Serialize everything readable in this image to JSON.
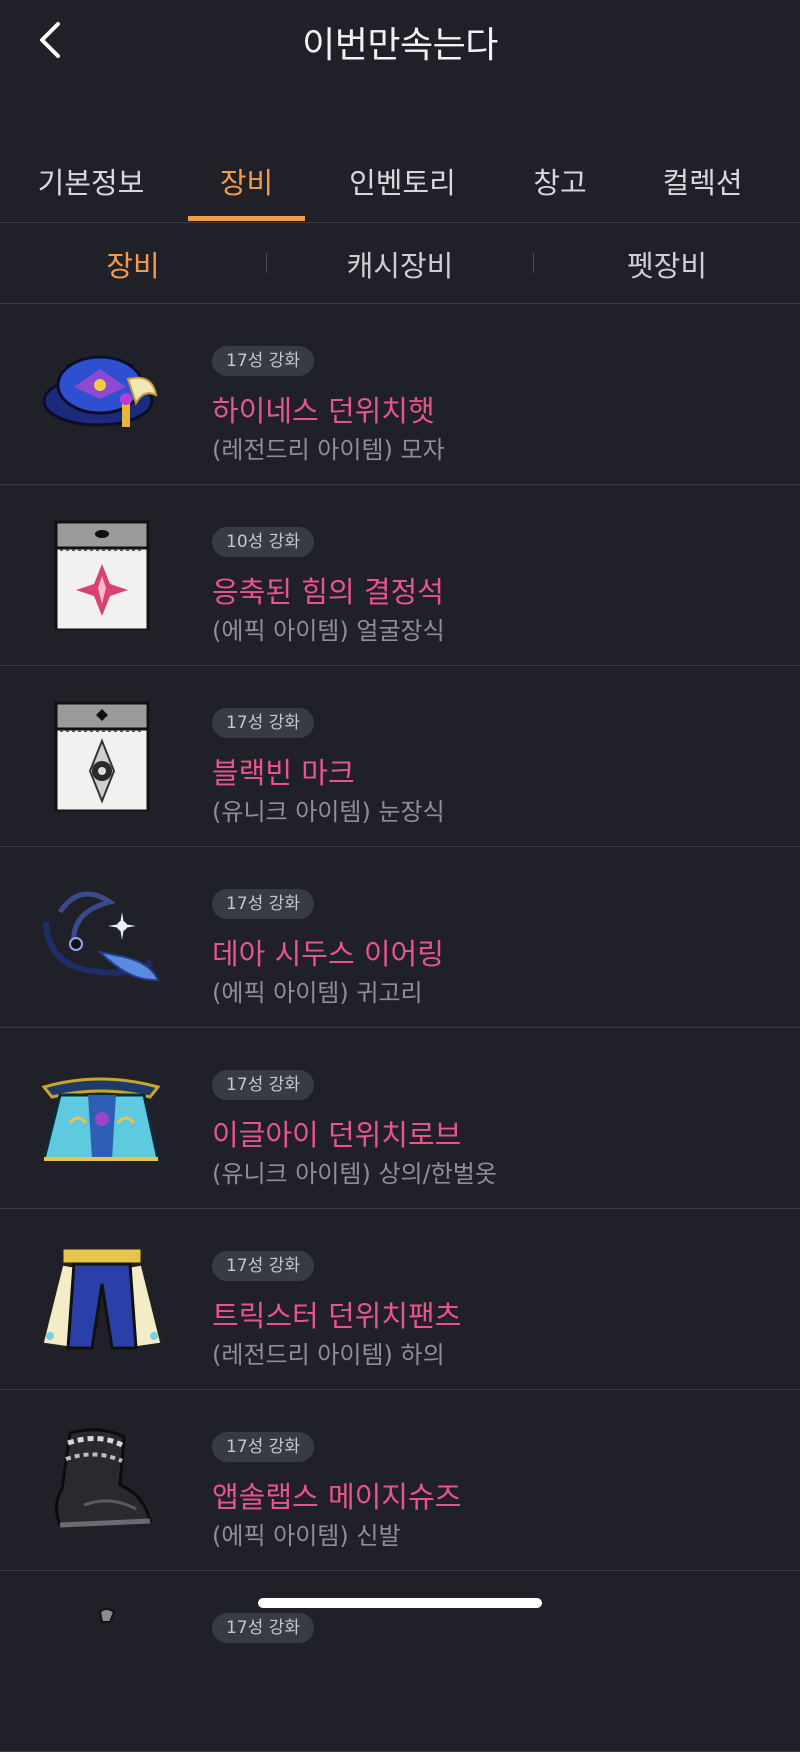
{
  "header": {
    "title": "이번만속는다",
    "back_icon": "chevron-left-icon"
  },
  "main_tabs": [
    {
      "label": "기본정보",
      "active": false
    },
    {
      "label": "장비",
      "active": true
    },
    {
      "label": "인벤토리",
      "active": false
    },
    {
      "label": "창고",
      "active": false
    },
    {
      "label": "컬렉션",
      "active": false
    }
  ],
  "sub_tabs": [
    {
      "label": "장비",
      "active": true
    },
    {
      "label": "캐시장비",
      "active": false
    },
    {
      "label": "펫장비",
      "active": false
    }
  ],
  "items": [
    {
      "badge": "17성 강화",
      "name": "하이네스 던위치햇",
      "type": "(레전드리 아이템) 모자",
      "icon": "hat-icon"
    },
    {
      "badge": "10성 강화",
      "name": "응축된 힘의 결정석",
      "type": "(에픽 아이템) 얼굴장식",
      "icon": "face-accessory-icon"
    },
    {
      "badge": "17성 강화",
      "name": "블랙빈 마크",
      "type": "(유니크 아이템) 눈장식",
      "icon": "eye-accessory-icon"
    },
    {
      "badge": "17성 강화",
      "name": "데아 시두스 이어링",
      "type": "(에픽 아이템) 귀고리",
      "icon": "earring-icon"
    },
    {
      "badge": "17성 강화",
      "name": "이글아이 던위치로브",
      "type": "(유니크 아이템) 상의/한벌옷",
      "icon": "robe-icon"
    },
    {
      "badge": "17성 강화",
      "name": "트릭스터 던위치팬츠",
      "type": "(레전드리 아이템) 하의",
      "icon": "pants-icon"
    },
    {
      "badge": "17성 강화",
      "name": "앱솔랩스 메이지슈즈",
      "type": "(에픽 아이템) 신발",
      "icon": "shoes-icon"
    },
    {
      "badge": "17성 강화",
      "name": "",
      "type": "",
      "icon": "item-icon"
    }
  ],
  "colors": {
    "background": "#202128",
    "accent": "#f59a4c",
    "item_name": "#e8558a",
    "badge_bg": "#383a45"
  }
}
